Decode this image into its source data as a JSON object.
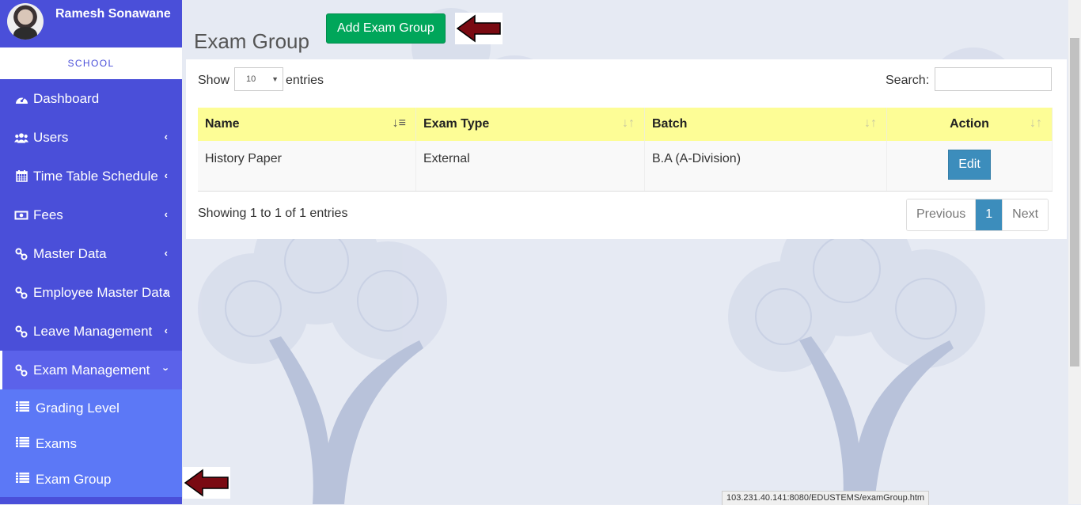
{
  "user": {
    "name": "Ramesh Sonawane"
  },
  "brand": "SCHOOL",
  "sidebar": {
    "items": [
      {
        "label": "Dashboard",
        "icon": "dashboard-icon"
      },
      {
        "label": "Users",
        "icon": "users-icon"
      },
      {
        "label": "Time Table Schedule",
        "icon": "calendar-icon"
      },
      {
        "label": "Fees",
        "icon": "money-icon"
      },
      {
        "label": "Master Data",
        "icon": "link-icon"
      },
      {
        "label": "Employee Master Data",
        "icon": "link-icon"
      },
      {
        "label": "Leave Management",
        "icon": "link-icon"
      },
      {
        "label": "Exam Management",
        "icon": "link-icon"
      }
    ],
    "submenu": [
      {
        "label": "Grading Level",
        "icon": "list-icon"
      },
      {
        "label": "Exams",
        "icon": "list-icon"
      },
      {
        "label": "Exam Group",
        "icon": "list-icon"
      }
    ]
  },
  "page": {
    "title": "Exam Group",
    "add_button": "Add Exam Group"
  },
  "table_controls": {
    "show_label": "Show",
    "page_length": "10",
    "entries_label": "entries",
    "search_label": "Search:",
    "search_value": ""
  },
  "table": {
    "columns": [
      "Name",
      "Exam Type",
      "Batch",
      "Action"
    ],
    "rows": [
      {
        "name": "History Paper",
        "exam_type": "External",
        "batch": "B.A (A-Division)",
        "action": "Edit"
      }
    ]
  },
  "footer": {
    "info": "Showing 1 to 1 of 1 entries",
    "previous": "Previous",
    "page": "1",
    "next": "Next"
  },
  "status_bar": {
    "url": "103.231.40.141:8080/EDUSTEMS/examGroup.htm"
  },
  "colors": {
    "sidebar": "#4a4fd9",
    "submenu": "#5c78f6",
    "add_button": "#00a65a",
    "edit_button": "#3c8dbc",
    "header_row": "#fdfd96",
    "arrow": "#7a0a12"
  }
}
